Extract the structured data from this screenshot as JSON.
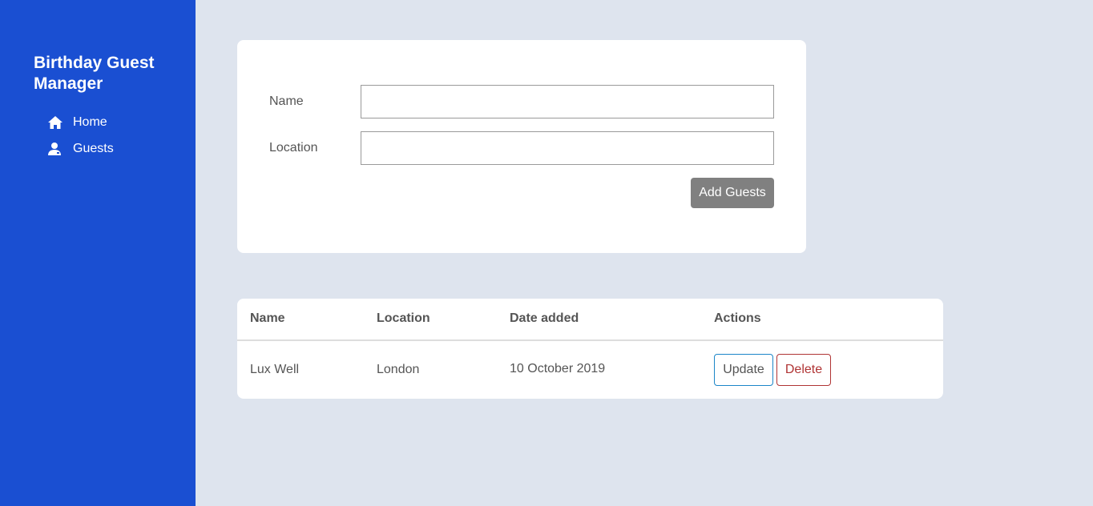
{
  "sidebar": {
    "title": "Birthday Guest Manager",
    "items": [
      {
        "label": "Home",
        "icon": "home-icon"
      },
      {
        "label": "Guests",
        "icon": "user-icon"
      }
    ]
  },
  "form": {
    "name_label": "Name",
    "name_value": "",
    "location_label": "Location",
    "location_value": "",
    "submit_label": "Add Guests"
  },
  "table": {
    "headers": [
      "Name",
      "Location",
      "Date added",
      "Actions"
    ],
    "rows": [
      {
        "name": "Lux Well",
        "location": "London",
        "date": "10 October 2019",
        "update_label": "Update",
        "delete_label": "Delete"
      }
    ]
  },
  "colors": {
    "sidebar": "#1a4fd2",
    "background": "#dee4ee",
    "update_border": "#1c86c8",
    "delete": "#b03434",
    "add_button": "#808080"
  }
}
